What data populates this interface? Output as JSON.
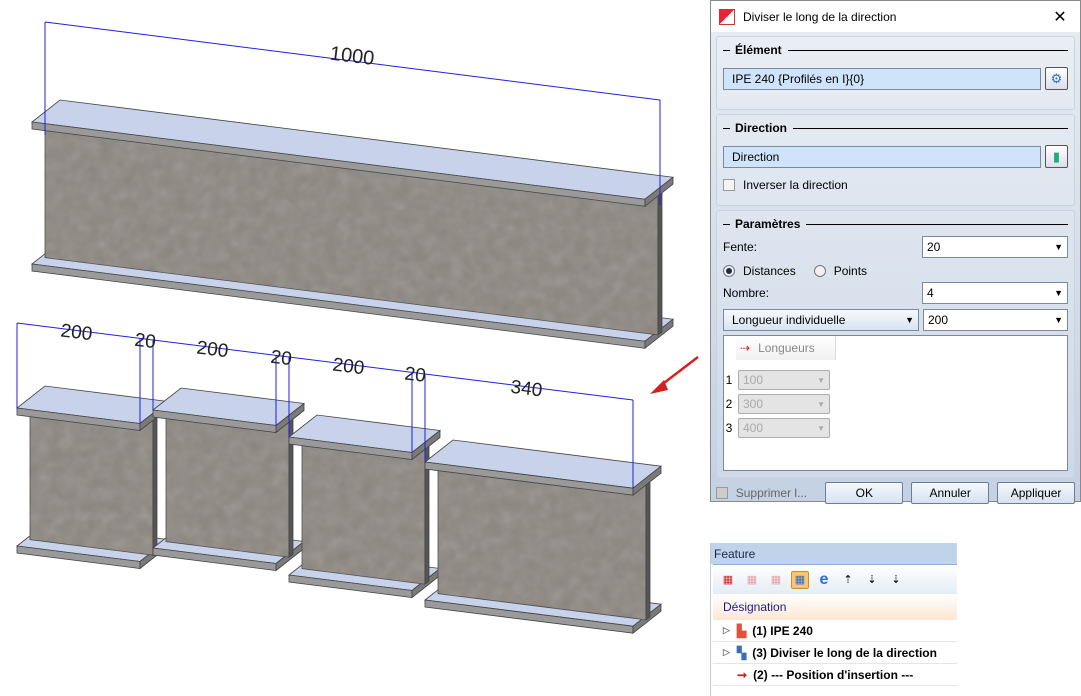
{
  "scene": {
    "top_dimension": "1000",
    "bottom_dimensions": [
      "200",
      "20",
      "200",
      "20",
      "200",
      "20",
      "340"
    ],
    "colors": {
      "dimension": "#2020e0",
      "flange": "#c8d2ea",
      "web": "#8c8680",
      "arrow": "#d42020"
    }
  },
  "dialog": {
    "title": "Diviser le long de la direction",
    "element": {
      "heading": "Élément",
      "value": "IPE 240 {Profilés en I}{0}"
    },
    "direction": {
      "heading": "Direction",
      "value": "Direction",
      "invert_label": "Inverser la direction"
    },
    "params": {
      "heading": "Paramètres",
      "fente_label": "Fente:",
      "fente_value": "20",
      "radio_distances": "Distances",
      "radio_points": "Points",
      "nombre_label": "Nombre:",
      "nombre_value": "4",
      "mode_value": "Longueur individuelle",
      "mode_amount": "200",
      "grid_header": "Longueurs",
      "rows": [
        {
          "n": "1",
          "v": "100"
        },
        {
          "n": "2",
          "v": "300"
        },
        {
          "n": "3",
          "v": "400"
        }
      ]
    },
    "supprimer_label": "Supprimer l...",
    "ok": "OK",
    "cancel": "Annuler",
    "apply": "Appliquer"
  },
  "feature": {
    "title": "Feature",
    "column": "Désignation",
    "items": [
      "(1) IPE 240",
      "(3) Diviser le long de la direction",
      "(2) --- Position  d'insertion ---"
    ]
  }
}
